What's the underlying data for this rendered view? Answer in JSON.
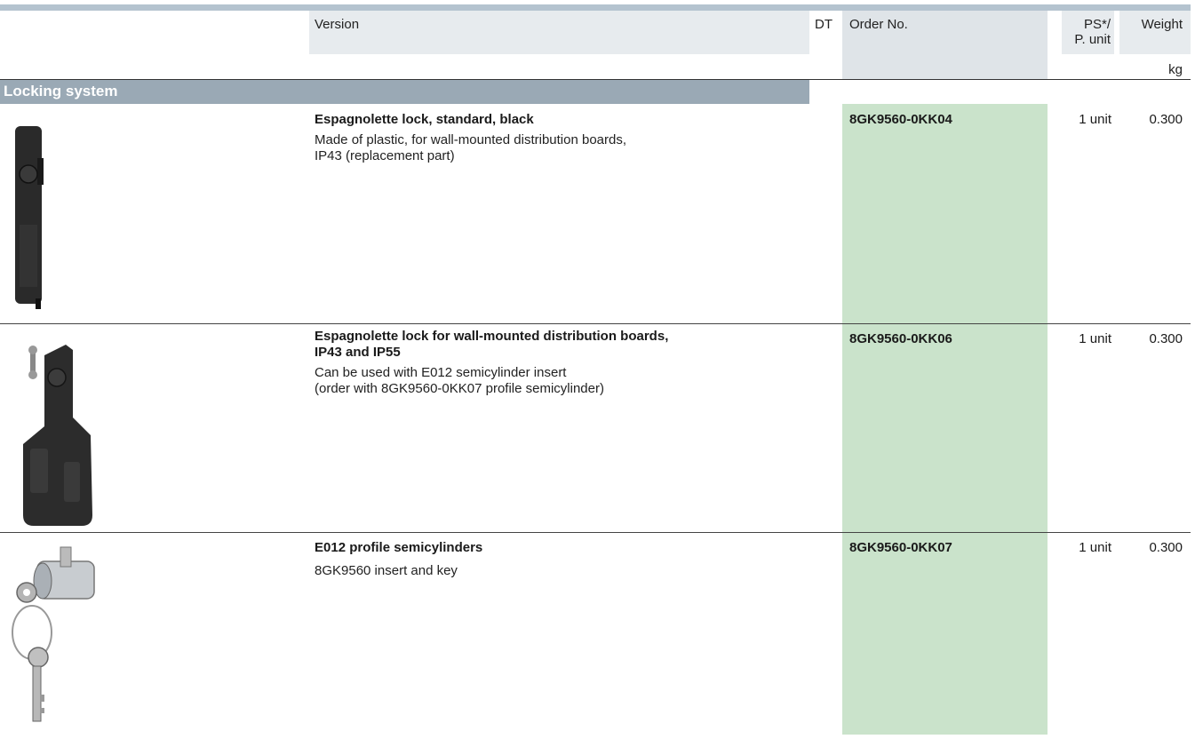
{
  "header": {
    "version": "Version",
    "dt": "DT",
    "order_no": "Order No.",
    "ps_line1": "PS*/",
    "ps_line2": "P. unit",
    "weight": "Weight",
    "weight_unit": "kg"
  },
  "section": {
    "title": "Locking system"
  },
  "rows": [
    {
      "title": "Espagnolette lock, standard, black",
      "desc_lines": [
        "Made of plastic, for wall-mounted distribution boards,",
        "IP43 (replacement part)"
      ],
      "order_no": "8GK9560-0KK04",
      "ps": "1 unit",
      "weight": "0.300",
      "image": "black-espagnolette-lock-photo"
    },
    {
      "title_lines": [
        "Espagnolette lock for wall-mounted distribution boards,",
        "IP43 and IP55"
      ],
      "desc_lines": [
        "Can be used with E012 semicylinder insert",
        "(order with 8GK9560-0KK07 profile semicylinder)"
      ],
      "order_no": "8GK9560-0KK06",
      "ps": "1 unit",
      "weight": "0.300",
      "image": "espagnolette-lock-ip55-photo"
    },
    {
      "title": "E012 profile semicylinders",
      "desc_lines": [
        "8GK9560 insert and key"
      ],
      "order_no": "8GK9560-0KK07",
      "ps": "1 unit",
      "weight": "0.300",
      "image": "semicylinder-with-keys-photo"
    }
  ],
  "colors": {
    "section_bar": "#9aa9b5",
    "order_highlight": "#cae3cb",
    "header_band": "#b4c3cf"
  }
}
